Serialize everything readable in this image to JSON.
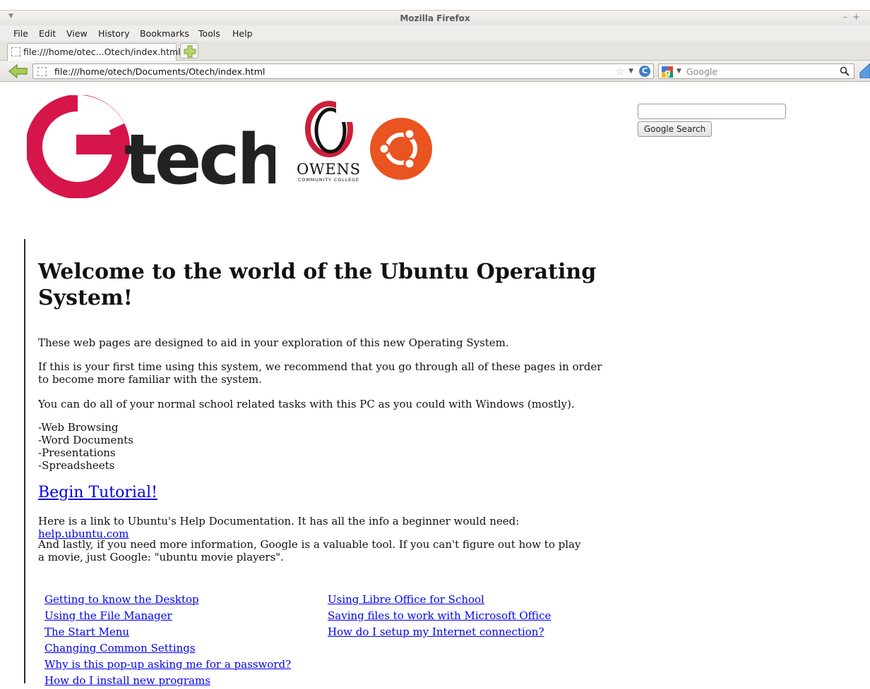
{
  "window": {
    "title": "Mozilla Firefox"
  },
  "menu": {
    "items": [
      "File",
      "Edit",
      "View",
      "History",
      "Bookmarks",
      "Tools",
      "Help"
    ]
  },
  "tabs": [
    {
      "label": "file:///home/otec...Otech/index.html"
    }
  ],
  "navbar": {
    "url": "file:///home/otech/Documents/Otech/index.html",
    "search_placeholder": "Google"
  },
  "logos": {
    "owens_name": "OWENS",
    "owens_sub": "COMMUNITY COLLEGE",
    "otech_text": "tech"
  },
  "google_search": {
    "input_value": "",
    "button_label": "Google Search"
  },
  "main": {
    "heading_line1": "Welcome to the world of the Ubuntu Operating",
    "heading_line2": "System!",
    "p1": "These web pages are designed to aid in your exploration of this new Operating System.",
    "p2": "If this is your first time using this system, we recommend that you go through all of these pages in order to become more familiar with the system.",
    "p3": "You can do all of your normal school related tasks with this PC as you could with Windows (mostly).",
    "tasks": [
      "-Web Browsing",
      "-Word Documents",
      "-Presentations",
      "-Spreadsheets"
    ],
    "begin_tutorial": "Begin Tutorial!",
    "p5_text": "Here is a link to Ubuntu's Help Documentation. It has all the info a beginner would need: ",
    "p5_link": "help.ubuntu.com",
    "p6": "And lastly, if you need more information, Google is a valuable tool. If you can't figure out how to play a movie, just Google: \"ubuntu movie players\"."
  },
  "links_left": [
    "Getting to know the Desktop",
    "Using the File Manager",
    "The Start Menu",
    "Changing Common Settings",
    "Why is this pop-up asking me for a password?",
    "How do I install new programs"
  ],
  "links_right": [
    "Using Libre Office for School",
    "Saving files to work with Microsoft Office",
    "How do I setup my Internet connection?"
  ],
  "colors": {
    "link": "#0000ee",
    "otech_red": "#d6154a",
    "ubuntu_orange": "#e95420"
  }
}
